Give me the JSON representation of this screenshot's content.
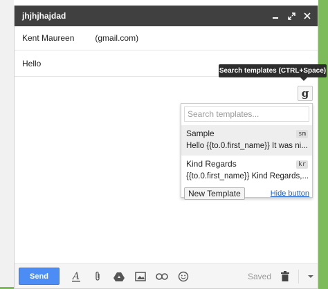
{
  "window": {
    "title": "jhjhjhajdad"
  },
  "recipient": {
    "name": "Kent Maureen",
    "email": "(gmail.com)"
  },
  "subject": "Hello",
  "tooltip": "Search templates (CTRL+Space)",
  "template_button": "g",
  "templates_panel": {
    "search_placeholder": "Search templates...",
    "items": [
      {
        "name": "Sample",
        "shortcut": "sm",
        "preview": "Hello {{to.0.first_name}} It was ni..."
      },
      {
        "name": "Kind Regards",
        "shortcut": "kr",
        "preview": "{{to.0.first_name}} Kind Regards,..."
      }
    ],
    "new_template_label": "New Template",
    "hide_label": "Hide button"
  },
  "toolbar": {
    "send_label": "Send",
    "saved_label": "Saved"
  },
  "icons": [
    "minimize-icon",
    "popout-icon",
    "close-icon",
    "text-format-icon",
    "attach-icon",
    "drive-icon",
    "photo-icon",
    "link-icon",
    "emoji-icon",
    "trash-icon",
    "more-options-icon"
  ],
  "colors": {
    "titlebar": "#404040",
    "send_button": "#4c8cf5",
    "link": "#1a5fd8",
    "accent_green": "#7cba5a"
  }
}
